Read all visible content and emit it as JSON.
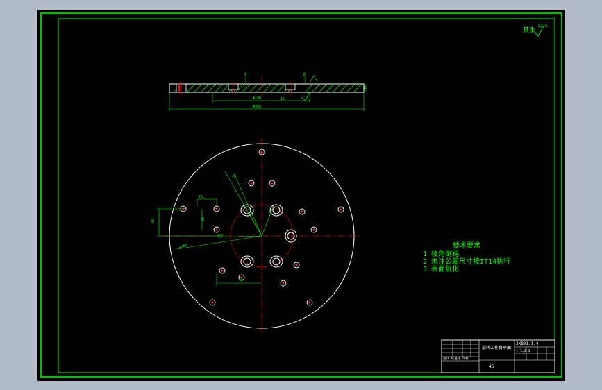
{
  "colors": {
    "background": "#000000",
    "frame": "#00ff00",
    "outline": "#ffffff",
    "centerline": "#ff0000",
    "hole": "#ff3030",
    "annotation": "#00ff00"
  },
  "roughness_note": {
    "label": "其余",
    "value": "12.5"
  },
  "section_view": {
    "dim_bottom_inner": "Φ100",
    "dim_bottom_outer": "Φ300",
    "dim_top_right": "2",
    "dim_mid": "12",
    "dim_left_top": "5",
    "dim_right_side": "8"
  },
  "plan_view": {
    "dim_angle": "30°",
    "dim_vertical": "40",
    "dim_small_w": "20",
    "dim_radius": "R40",
    "dim_bottom": "60",
    "dim_hole_note": "6×Φ8",
    "dim_left_tag": "20"
  },
  "tech_requirements": {
    "title": "技术要求",
    "items": [
      "1 棱角倒钝",
      "2 未注公差尺寸按IT14执行",
      "3 表面氧化"
    ]
  },
  "title_block": {
    "part_name": "旋转工作台平面",
    "drawing_no": "JXB01.1.4",
    "material": "45",
    "scale_row": "1 1:2 2",
    "small_cells": "设计 标准化 审核"
  }
}
